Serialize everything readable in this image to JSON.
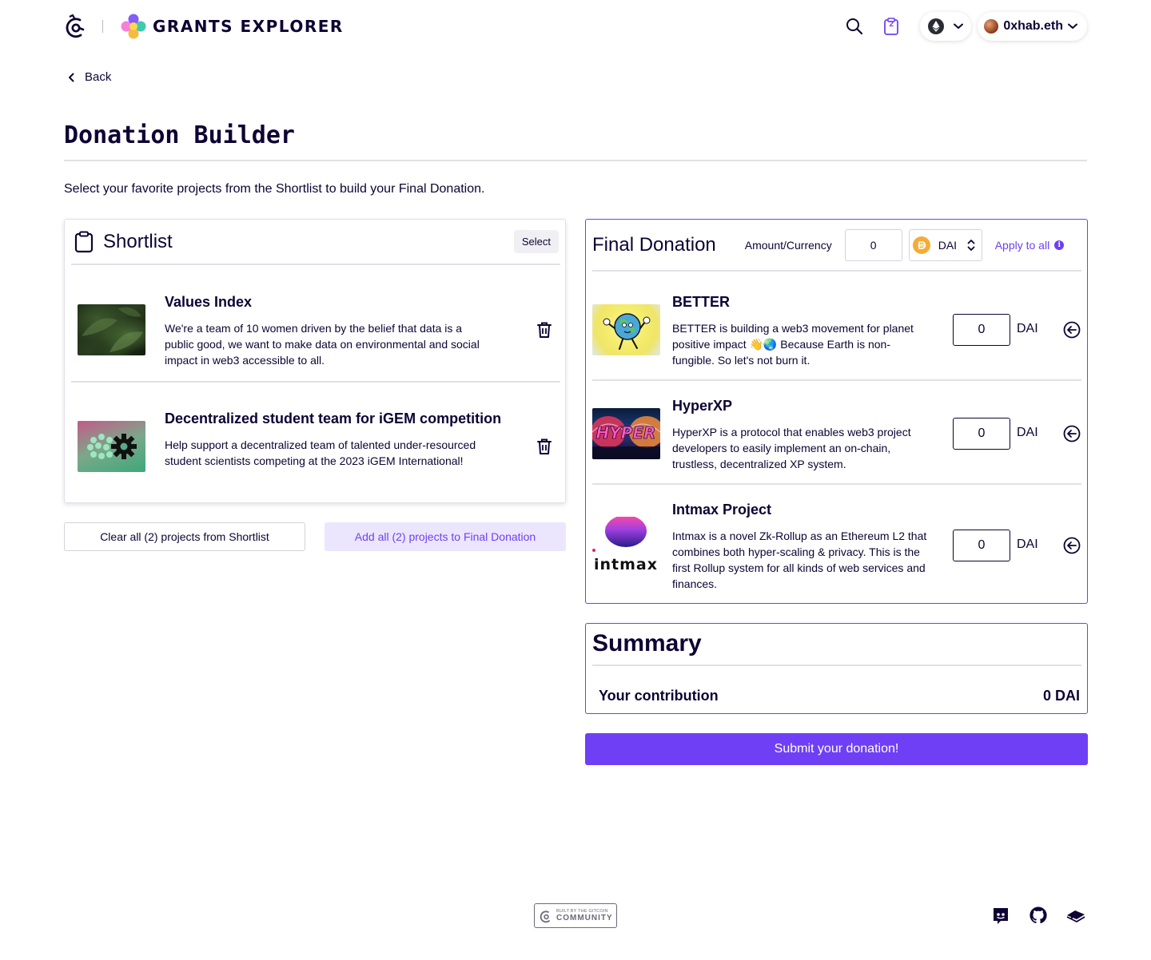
{
  "header": {
    "brand": "GRANTS EXPLORER",
    "cart_count": "2",
    "chain_icon": "ethereum-icon",
    "user_name": "0xhab.eth"
  },
  "nav": {
    "back_label": "Back"
  },
  "page": {
    "title": "Donation Builder",
    "intro": "Select your favorite projects from the Shortlist to build your Final Donation."
  },
  "shortlist": {
    "title": "Shortlist",
    "select_label": "Select",
    "items": [
      {
        "title": "Values Index",
        "description": "We're a team of 10 women driven by the belief that data is a public good, we want to make data on environmental and social impact in web3 accessible to all."
      },
      {
        "title": "Decentralized student team for iGEM competition",
        "description": "Help support a decentralized team of talented under-resourced student scientists competing at the 2023 iGEM International!"
      }
    ],
    "clear_label": "Clear all (2) projects from Shortlist",
    "add_all_label": "Add all (2) projects to Final Donation"
  },
  "final_donation": {
    "title": "Final Donation",
    "amount_label": "Amount/Currency",
    "amount_value": "0",
    "currency": "DAI",
    "apply_all_label": "Apply to all",
    "items": [
      {
        "title": "BETTER",
        "description": "BETTER is building a web3 movement for planet positive impact 👋🌏 Because Earth is non-fungible. So let's not burn it.",
        "amount": "0",
        "currency": "DAI"
      },
      {
        "title": "HyperXP",
        "description": "HyperXP is a protocol that enables web3 project developers to easily implement an on-chain, trustless, decentralized XP system.",
        "amount": "0",
        "currency": "DAI"
      },
      {
        "title": "Intmax Project",
        "description": "Intmax is a novel Zk-Rollup as an Ethereum L2 that combines both hyper-scaling & privacy. This is the first Rollup system for all kinds of web services and finances.",
        "amount": "0",
        "currency": "DAI",
        "logo_text": "intmax"
      }
    ]
  },
  "summary": {
    "title": "Summary",
    "contribution_label": "Your contribution",
    "contribution_value": "0 DAI"
  },
  "submit_label": "Submit your donation!",
  "footer": {
    "badge_small": "BUILT BY THE GITCOIN",
    "badge_big": "COMMUNITY",
    "icons": [
      "discord-icon",
      "github-icon",
      "gitbook-icon"
    ]
  },
  "colors": {
    "accent": "#6f3ff5",
    "text": "#0e0333",
    "accent_soft": "#ebe6fd",
    "border": "#e2e0e7"
  }
}
